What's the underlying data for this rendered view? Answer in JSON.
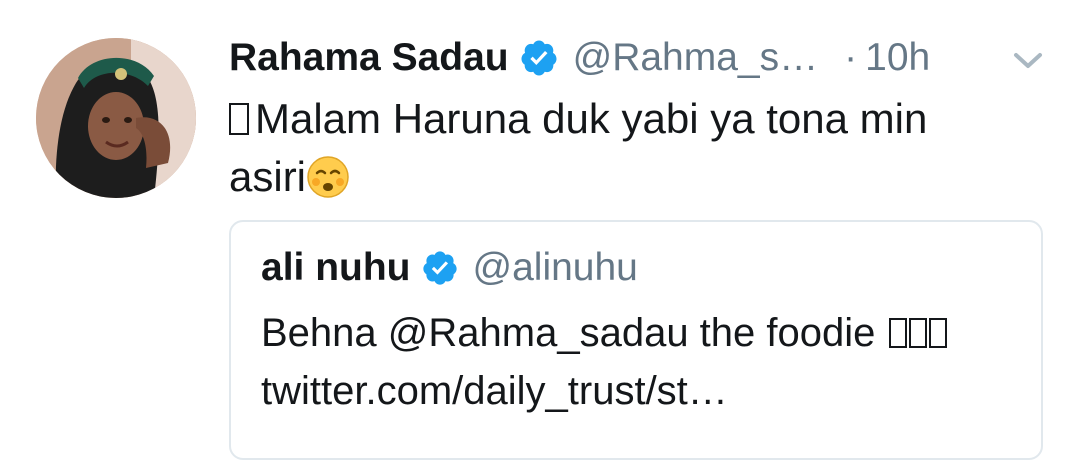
{
  "tweet": {
    "display_name": "Rahama Sadau",
    "handle": "@Rahma_s…",
    "separator": "·",
    "time": "10h",
    "text_line1": "Malam Haruna duk yabi ya tona min",
    "text_line2": "asiri",
    "emoji_icon": "flushed-face-icon",
    "verified_icon": "verified-badge-icon",
    "more_icon": "chevron-down-icon"
  },
  "quote": {
    "display_name": "ali nuhu",
    "handle": "@alinuhu",
    "text_line1": "Behna @Rahma_sadau the foodie",
    "text_line2": "twitter.com/daily_trust/st…"
  },
  "colors": {
    "verified_blue": "#1da1f2",
    "secondary_text": "#657786",
    "primary_text": "#14171a",
    "border": "#e1e8ed"
  }
}
